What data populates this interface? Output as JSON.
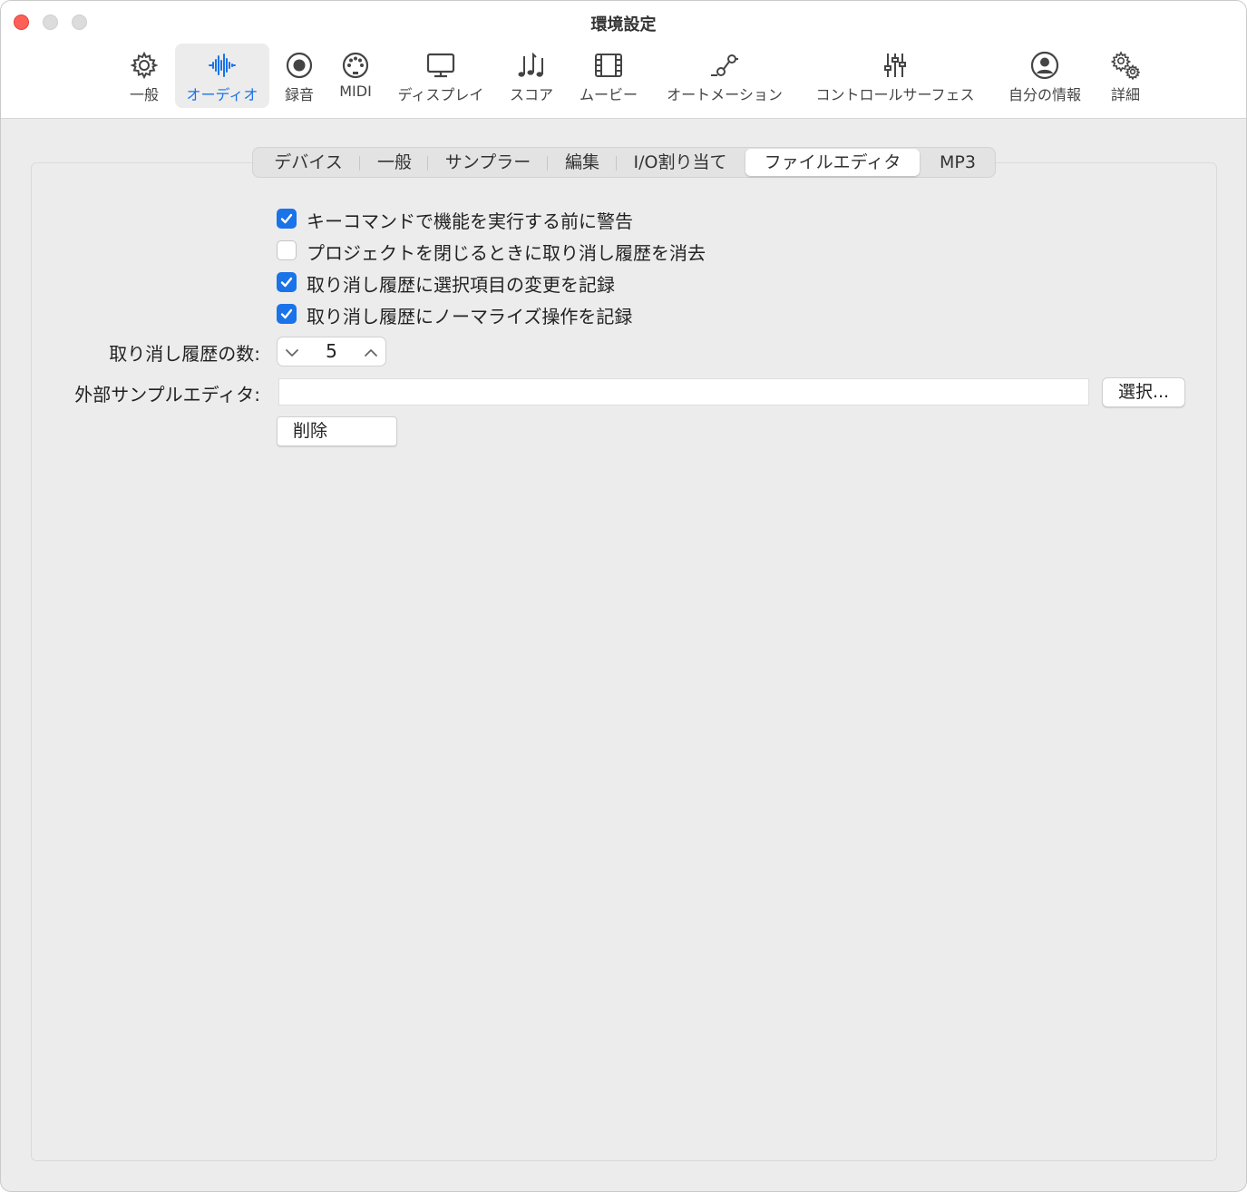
{
  "window": {
    "title": "環境設定"
  },
  "toolbar": {
    "items": [
      {
        "label": "一般",
        "icon": "gear-icon"
      },
      {
        "label": "オーディオ",
        "icon": "waveform-icon",
        "active": true
      },
      {
        "label": "録音",
        "icon": "record-icon"
      },
      {
        "label": "MIDI",
        "icon": "midi-port-icon"
      },
      {
        "label": "ディスプレイ",
        "icon": "display-icon"
      },
      {
        "label": "スコア",
        "icon": "music-notes-icon"
      },
      {
        "label": "ムービー",
        "icon": "film-icon"
      },
      {
        "label": "オートメーション",
        "icon": "automation-curve-icon"
      },
      {
        "label": "コントロールサーフェス",
        "icon": "faders-icon"
      },
      {
        "label": "自分の情報",
        "icon": "user-circle-icon"
      },
      {
        "label": "詳細",
        "icon": "gears-icon"
      }
    ],
    "accent_color": "#1a73e8"
  },
  "tabs": [
    {
      "label": "デバイス"
    },
    {
      "label": "一般"
    },
    {
      "label": "サンプラー"
    },
    {
      "label": "編集"
    },
    {
      "label": "I/O割り当て"
    },
    {
      "label": "ファイルエディタ",
      "selected": true
    },
    {
      "label": "MP3"
    }
  ],
  "options": [
    {
      "label": "キーコマンドで機能を実行する前に警告",
      "checked": true
    },
    {
      "label": "プロジェクトを閉じるときに取り消し履歴を消去",
      "checked": false
    },
    {
      "label": "取り消し履歴に選択項目の変更を記録",
      "checked": true
    },
    {
      "label": "取り消し履歴にノーマライズ操作を記録",
      "checked": true
    }
  ],
  "undo_history": {
    "label": "取り消し履歴の数:",
    "value": "5"
  },
  "external_editor": {
    "label": "外部サンプルエディタ:",
    "path_value": "",
    "choose_label": "選択...",
    "delete_label": "削除"
  }
}
